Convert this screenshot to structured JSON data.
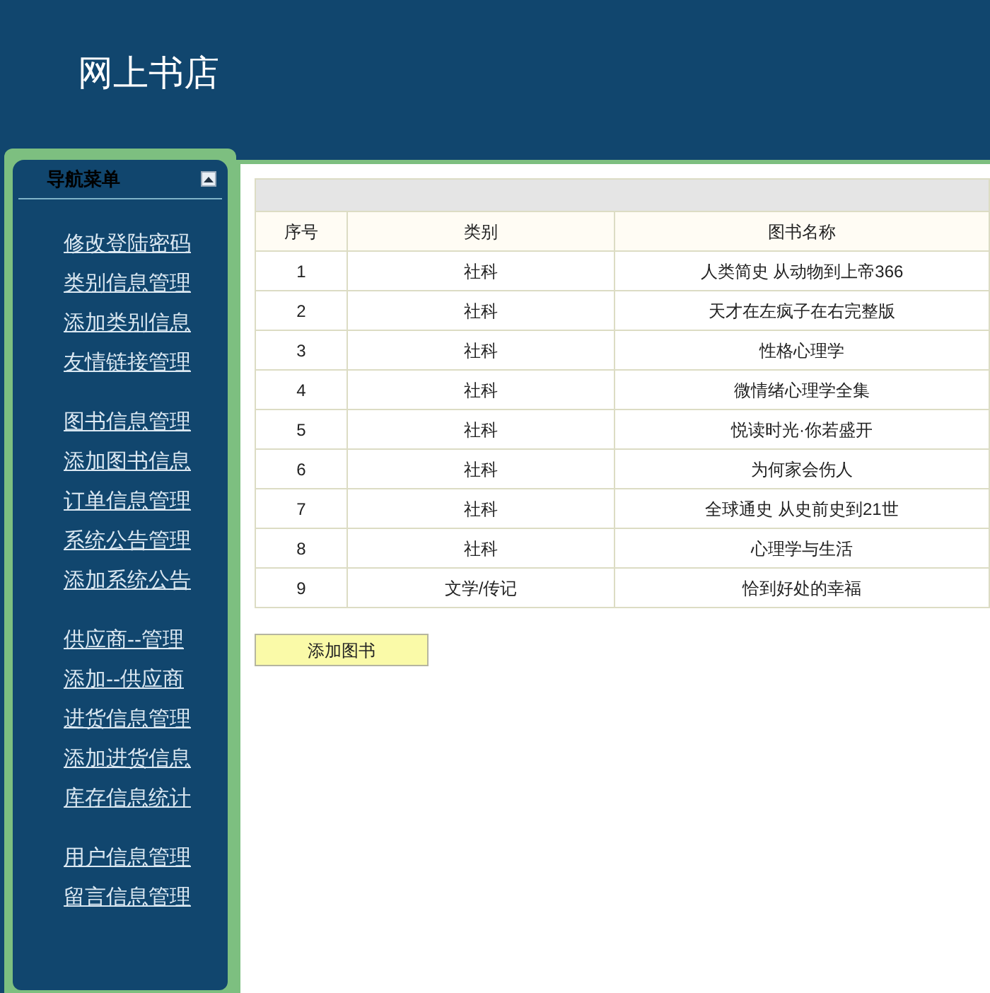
{
  "header": {
    "title": "网上书店"
  },
  "nav": {
    "title": "导航菜单",
    "groups": [
      [
        "修改登陆密码",
        "类别信息管理",
        "添加类别信息",
        "友情链接管理"
      ],
      [
        "图书信息管理",
        "添加图书信息",
        "订单信息管理",
        "系统公告管理",
        "添加系统公告"
      ],
      [
        "供应商--管理",
        "添加--供应商",
        "进货信息管理",
        "添加进货信息",
        "库存信息统计"
      ],
      [
        "用户信息管理",
        "留言信息管理"
      ]
    ]
  },
  "table": {
    "columns": [
      "序号",
      "类别",
      "图书名称"
    ],
    "rows": [
      [
        "1",
        "社科",
        "人类简史 从动物到上帝366"
      ],
      [
        "2",
        "社科",
        "天才在左疯子在右完整版"
      ],
      [
        "3",
        "社科",
        "性格心理学"
      ],
      [
        "4",
        "社科",
        "微情绪心理学全集"
      ],
      [
        "5",
        "社科",
        "悦读时光·你若盛开"
      ],
      [
        "6",
        "社科",
        "为何家会伤人"
      ],
      [
        "7",
        "社科",
        "全球通史 从史前史到21世"
      ],
      [
        "8",
        "社科",
        "心理学与生活"
      ],
      [
        "9",
        "文学/传记",
        "恰到好处的幸福"
      ]
    ]
  },
  "add_button": "添加图书"
}
